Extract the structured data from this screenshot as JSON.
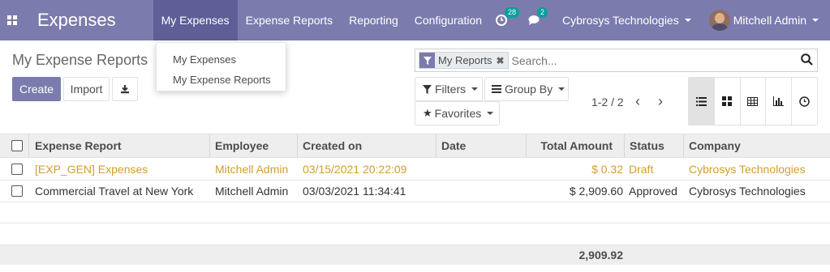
{
  "app": {
    "title": "Expenses"
  },
  "nav": {
    "menu": [
      "My Expenses",
      "Expense Reports",
      "Reporting",
      "Configuration"
    ],
    "activities_count": "28",
    "messages_count": "2",
    "company": "Cybrosys Technologies",
    "user": "Mitchell Admin"
  },
  "dropdown": {
    "items": [
      "My Expenses",
      "My Expense Reports"
    ]
  },
  "page": {
    "title": "My Expense Reports"
  },
  "buttons": {
    "create": "Create",
    "import": "Import"
  },
  "search": {
    "facet": "My Reports",
    "placeholder": "Search..."
  },
  "filters": {
    "filters": "Filters",
    "group_by": "Group By",
    "favorites": "Favorites"
  },
  "pager": {
    "text": "1-2 / 2"
  },
  "table": {
    "columns": [
      "Expense Report",
      "Employee",
      "Created on",
      "Date",
      "Total Amount",
      "Status",
      "Company"
    ],
    "rows": [
      [
        "[EXP_GEN] Expenses",
        "Mitchell Admin",
        "03/15/2021 20:22:09",
        "",
        "$ 0.32",
        "Draft",
        "Cybrosys Technologies"
      ],
      [
        "Commercial Travel at New York",
        "Mitchell Admin",
        "03/03/2021 11:34:41",
        "",
        "$ 2,909.60",
        "Approved",
        "Cybrosys Technologies"
      ]
    ],
    "total": "2,909.92"
  },
  "colors": {
    "brand": "#7c7bad",
    "brand_dark": "#5f5e97",
    "draft_row": "#d39e2c",
    "badge": "#00a09d"
  }
}
